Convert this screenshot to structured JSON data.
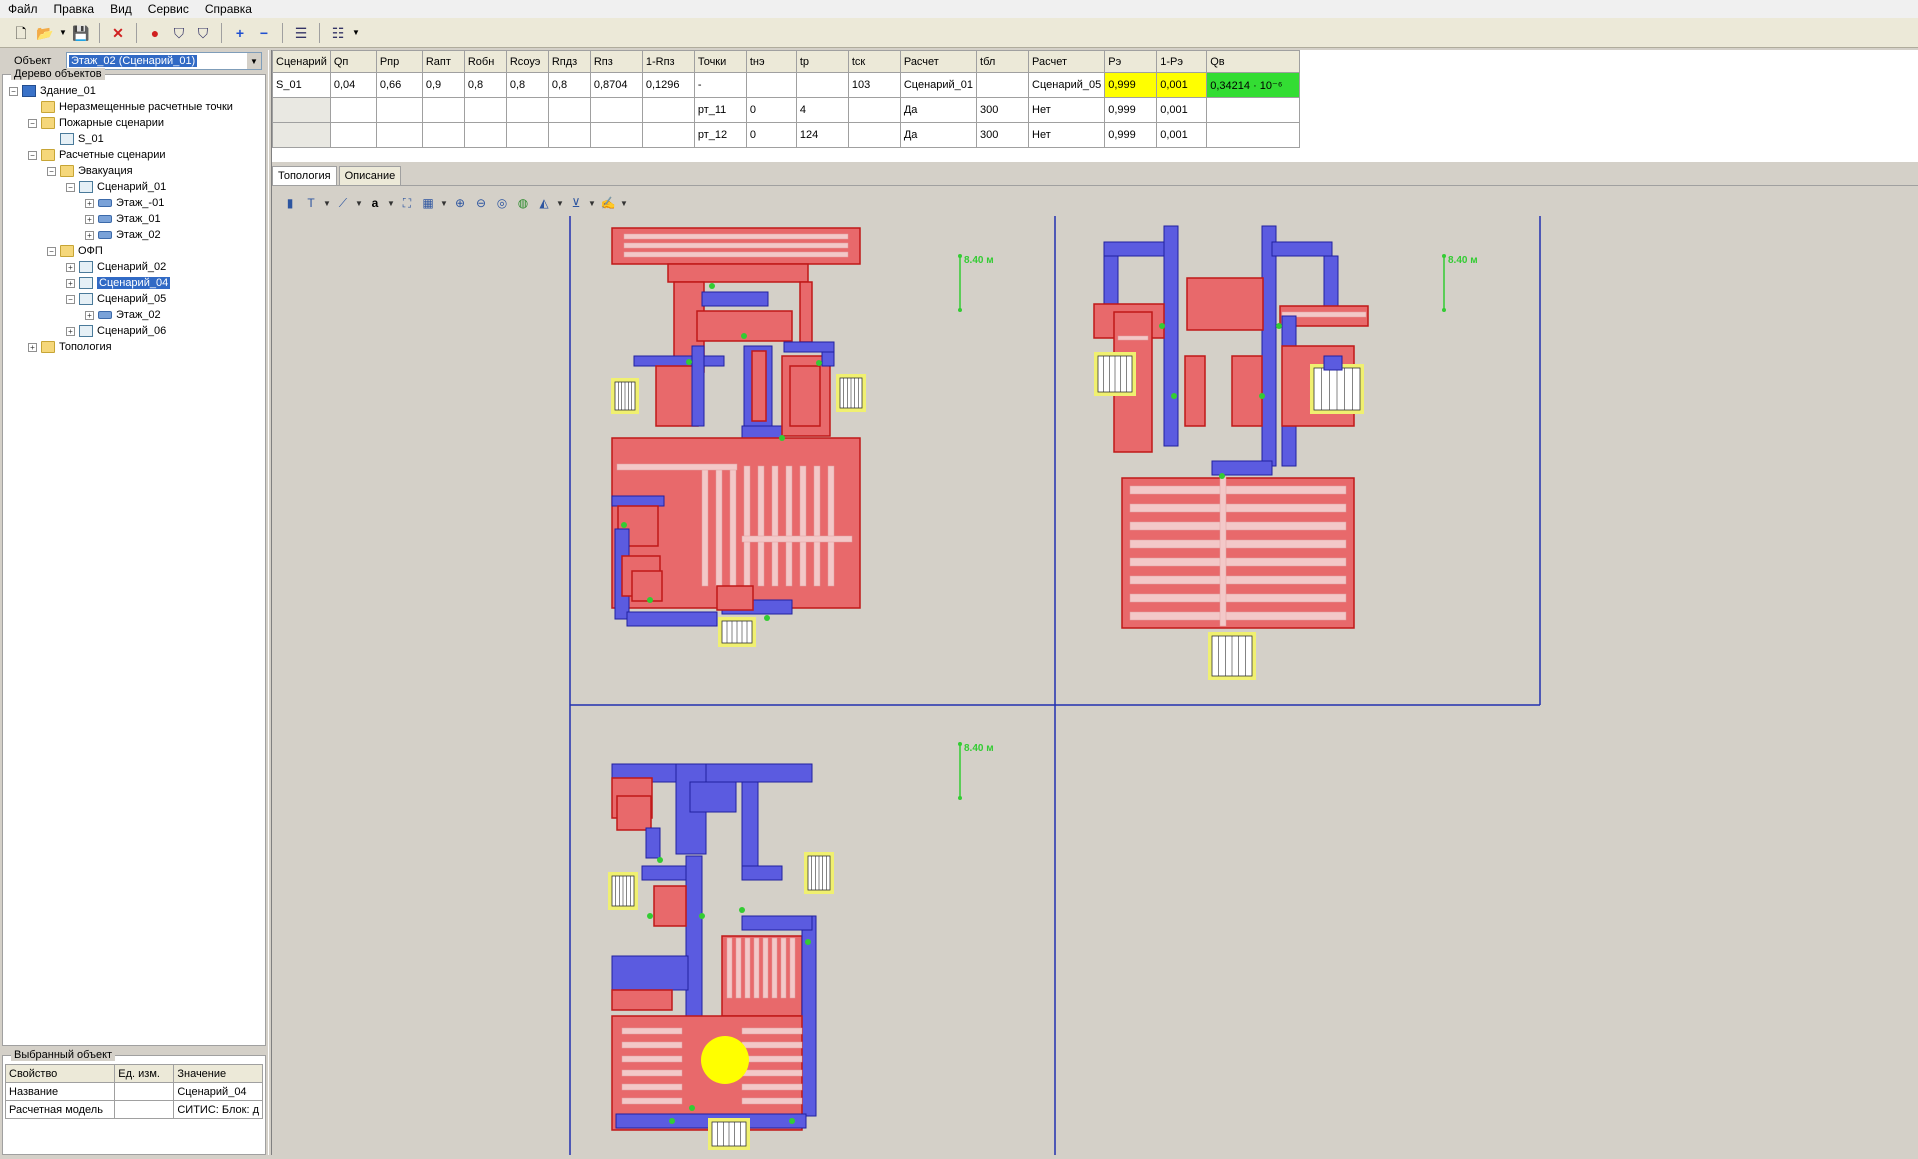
{
  "menu": [
    "Файл",
    "Правка",
    "Вид",
    "Сервис",
    "Справка"
  ],
  "object_selector": {
    "label": "Объект",
    "value": "Этаж_02 (Сценарий_01)"
  },
  "tree": {
    "caption": "Дерево объектов",
    "nodes": [
      {
        "label": "Здание_01",
        "icon": "building-icon",
        "expander": "-",
        "level": 0
      },
      {
        "label": "Неразмещенные расчетные точки",
        "icon": "folder-icon",
        "expander": "",
        "level": 1
      },
      {
        "label": "Пожарные сценарии",
        "icon": "folder-icon",
        "expander": "-",
        "level": 1
      },
      {
        "label": "S_01",
        "icon": "fire-scenario-icon",
        "expander": "",
        "level": 2
      },
      {
        "label": "Расчетные сценарии",
        "icon": "folder-icon",
        "expander": "-",
        "level": 1
      },
      {
        "label": "Эвакуация",
        "icon": "folder-icon",
        "expander": "-",
        "level": 2
      },
      {
        "label": "Сценарий_01",
        "icon": "scenario-icon",
        "expander": "-",
        "level": 3
      },
      {
        "label": "Этаж_-01",
        "icon": "floor-icon",
        "expander": "+",
        "level": 4
      },
      {
        "label": "Этаж_01",
        "icon": "floor-icon",
        "expander": "+",
        "level": 4
      },
      {
        "label": "Этаж_02",
        "icon": "floor-icon",
        "expander": "+",
        "level": 4
      },
      {
        "label": "ОФП",
        "icon": "folder-icon",
        "expander": "-",
        "level": 2
      },
      {
        "label": "Сценарий_02",
        "icon": "scenario-icon",
        "expander": "+",
        "level": 3
      },
      {
        "label": "Сценарий_04",
        "icon": "scenario-icon",
        "expander": "+",
        "level": 3,
        "selected": true
      },
      {
        "label": "Сценарий_05",
        "icon": "scenario-icon",
        "expander": "-",
        "level": 3
      },
      {
        "label": "Этаж_02",
        "icon": "floor-icon",
        "expander": "+",
        "level": 4
      },
      {
        "label": "Сценарий_06",
        "icon": "scenario-icon",
        "expander": "+",
        "level": 3
      },
      {
        "label": "Топология",
        "icon": "folder-icon",
        "expander": "+",
        "level": 1
      }
    ]
  },
  "selected_object": {
    "caption": "Выбранный объект",
    "headers": [
      "Свойство",
      "Ед. изм.",
      "Значение"
    ],
    "rows": [
      [
        "Название",
        "",
        "Сценарий_04"
      ],
      [
        "Расчетная модель",
        "",
        "СИТИС: Блок: д"
      ]
    ]
  },
  "results_table": {
    "headers": [
      "Сценарий",
      "Qп",
      "Pпр",
      "Rапт",
      "Rобн",
      "Rсоуэ",
      "Rпдз",
      "Rпз",
      "1-Rпз",
      "Точки",
      "tнэ",
      "tр",
      "tск",
      "Расчет",
      "tбл",
      "Расчет",
      "Pэ",
      "1-Pэ",
      "Qв"
    ],
    "rows": [
      [
        "S_01",
        "0,04",
        "0,66",
        "0,9",
        "0,8",
        "0,8",
        "0,8",
        "0,8704",
        "0,1296",
        "-",
        "",
        "",
        "103",
        "Сценарий_01",
        "",
        "Сценарий_05",
        "0,999",
        "0,001",
        "0,34214 · 10⁻⁶"
      ],
      [
        "",
        "",
        "",
        "",
        "",
        "",
        "",
        "",
        "",
        "рт_11",
        "0",
        "4",
        "",
        "Да",
        "300",
        "Нет",
        "0,999",
        "0,001",
        ""
      ],
      [
        "",
        "",
        "",
        "",
        "",
        "",
        "",
        "",
        "",
        "рт_12",
        "0",
        "124",
        "",
        "Да",
        "300",
        "Нет",
        "0,999",
        "0,001",
        ""
      ]
    ]
  },
  "tabs": [
    "Топология",
    "Описание"
  ],
  "view_toolbar_icons": [
    "select-icon",
    "text-icon",
    "line-icon",
    "label-icon",
    "grid-icon",
    "zoom-in-icon",
    "zoom-out-icon",
    "zoom-fit-icon",
    "globe-icon",
    "layers-icon",
    "axis-icon",
    "annotate-icon"
  ],
  "plans": {
    "scale_label": "8.40 м",
    "colors": {
      "room": "#e8696b",
      "corridor": "#5b5be0",
      "stair": "#f0f070",
      "door": "#33cc33",
      "fire": "#ffff00",
      "frame": "#2230b0"
    }
  }
}
